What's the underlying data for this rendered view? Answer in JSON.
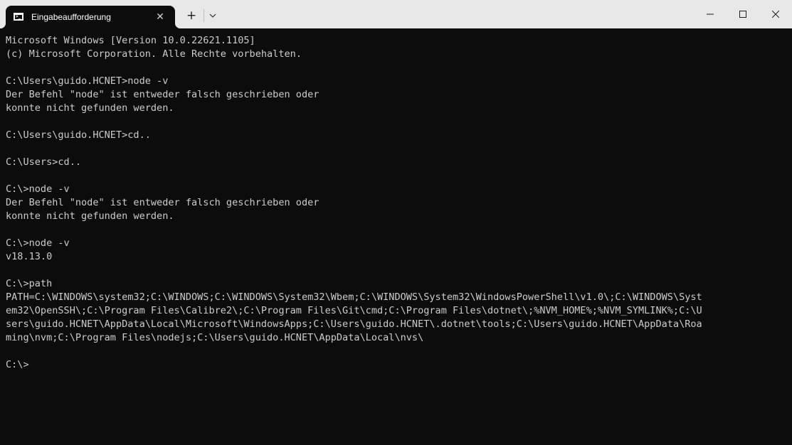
{
  "window": {
    "tab_title": "Eingabeaufforderung",
    "tab_icon": "cmd-icon",
    "controls": {
      "new_tab": "+",
      "close_tab": "✕"
    }
  },
  "terminal": {
    "lines": [
      "Microsoft Windows [Version 10.0.22621.1105]",
      "(c) Microsoft Corporation. Alle Rechte vorbehalten.",
      "",
      "C:\\Users\\guido.HCNET>node -v",
      "Der Befehl \"node\" ist entweder falsch geschrieben oder",
      "konnte nicht gefunden werden.",
      "",
      "C:\\Users\\guido.HCNET>cd..",
      "",
      "C:\\Users>cd..",
      "",
      "C:\\>node -v",
      "Der Befehl \"node\" ist entweder falsch geschrieben oder",
      "konnte nicht gefunden werden.",
      "",
      "C:\\>node -v",
      "v18.13.0",
      "",
      "C:\\>path",
      "PATH=C:\\WINDOWS\\system32;C:\\WINDOWS;C:\\WINDOWS\\System32\\Wbem;C:\\WINDOWS\\System32\\WindowsPowerShell\\v1.0\\;C:\\WINDOWS\\Syst",
      "em32\\OpenSSH\\;C:\\Program Files\\Calibre2\\;C:\\Program Files\\Git\\cmd;C:\\Program Files\\dotnet\\;%NVM_HOME%;%NVM_SYMLINK%;C:\\U",
      "sers\\guido.HCNET\\AppData\\Local\\Microsoft\\WindowsApps;C:\\Users\\guido.HCNET\\.dotnet\\tools;C:\\Users\\guido.HCNET\\AppData\\Roa",
      "ming\\nvm;C:\\Program Files\\nodejs;C:\\Users\\guido.HCNET\\AppData\\Local\\nvs\\",
      "",
      "C:\\>"
    ]
  },
  "colors": {
    "titlebar_bg": "#e8e8e8",
    "terminal_bg": "#0c0c0c",
    "terminal_fg": "#cccccc"
  }
}
